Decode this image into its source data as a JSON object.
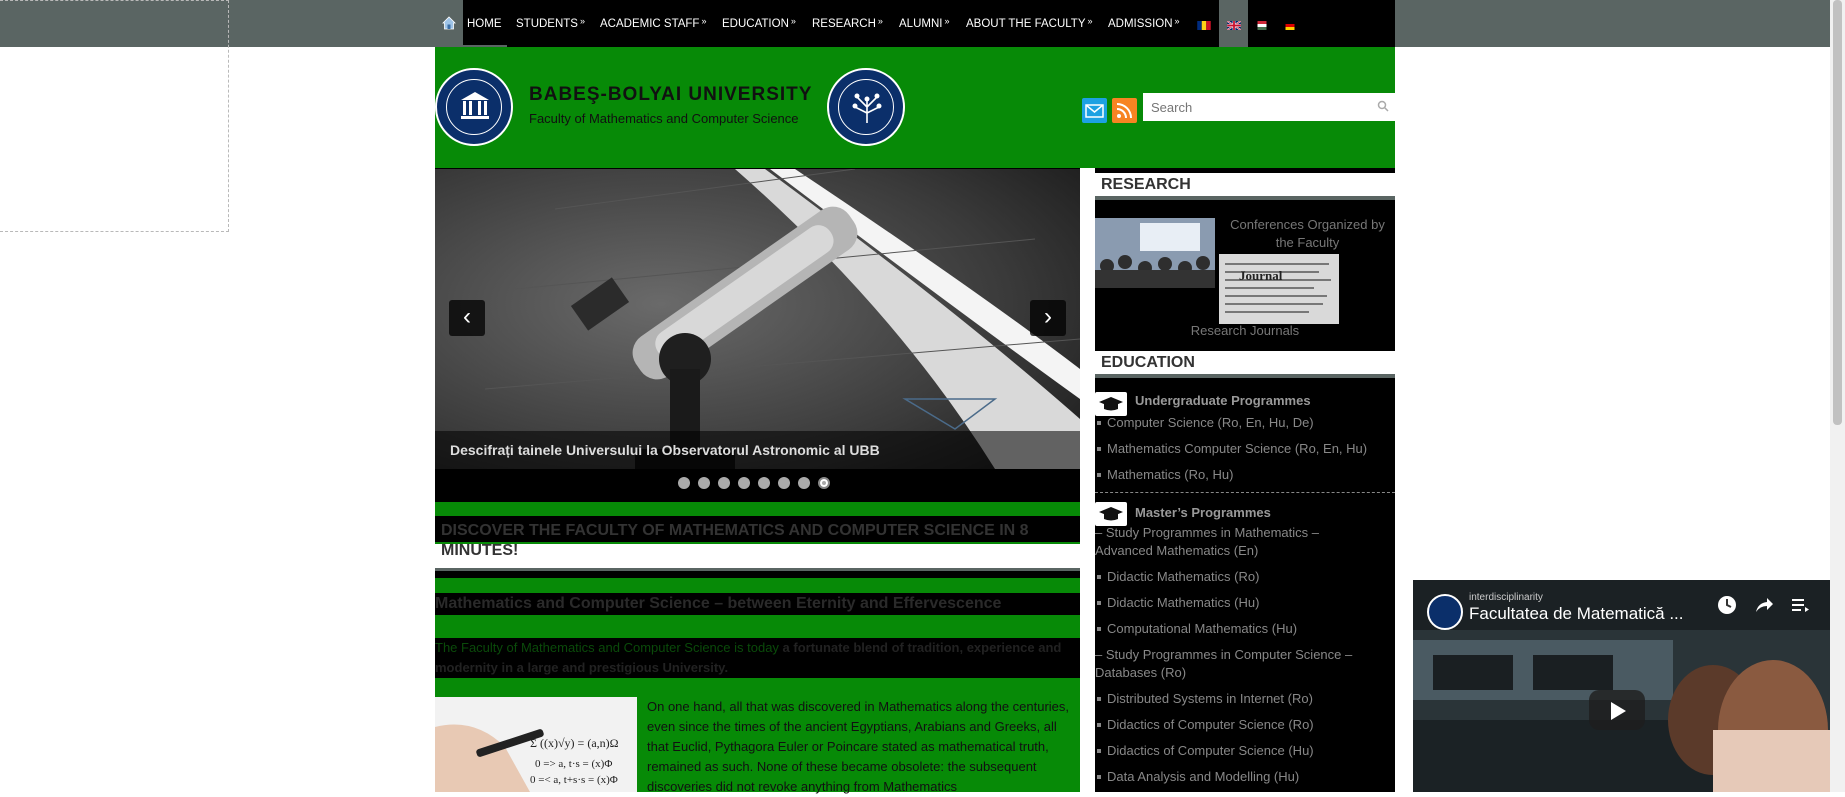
{
  "nav": {
    "items": [
      {
        "label": "HOME",
        "has_sub": false
      },
      {
        "label": "STUDENTS",
        "has_sub": true
      },
      {
        "label": "ACADEMIC STAFF",
        "has_sub": true
      },
      {
        "label": "EDUCATION",
        "has_sub": true
      },
      {
        "label": "RESEARCH",
        "has_sub": true
      },
      {
        "label": "ALUMNI",
        "has_sub": true
      },
      {
        "label": "ABOUT THE FACULTY",
        "has_sub": true
      },
      {
        "label": "ADMISSION",
        "has_sub": true
      }
    ],
    "submenu_marker": "»",
    "home_icon": "home-icon",
    "languages": [
      "ro",
      "en",
      "hu",
      "de"
    ],
    "active_language": "en"
  },
  "header": {
    "university": "BABEŞ-BOLYAI UNIVERSITY",
    "faculty": "Faculty of Mathematics and Computer Science",
    "search_placeholder": "Search",
    "icons": [
      "mail-icon",
      "rss-icon",
      "search-icon"
    ]
  },
  "slider": {
    "caption": "Descifrați tainele Universului la Observatorul Astronomic al UBB",
    "prev_label": "‹",
    "next_label": "›",
    "slide_count": 8,
    "active_slide": 8
  },
  "main": {
    "discover_title": "DISCOVER THE FACULTY OF MATHEMATICS AND COMPUTER SCIENCE IN 8 MINUTES!",
    "math_heading": "Mathematics and Computer Science – between Eternity and Effervescence",
    "intro_plain": "The Faculty of Mathematics and Computer Science is today ",
    "intro_bold": "a fortunate blend of tradition, experience and modernity in a large and prestigious University.",
    "body": "On one hand, all that was discovered in Mathematics along the centuries, even since the times of the ancient Egyptians, Arabians and Greeks, all that Euclid, Pythagora Euler or Poincare stated as mathematical truth, remained as such. None of these became obsolete: the subsequent discoveries did not revoke anything from Mathematics"
  },
  "sidebar": {
    "research": {
      "title": "RESEARCH",
      "conferences": "Conferences Organized by the Faculty",
      "journals": "Research Journals"
    },
    "education": {
      "title": "EDUCATION",
      "undergrad_heading": "Undergraduate Programmes",
      "undergrad": [
        "Computer Science (Ro, En, Hu, De)",
        "Mathematics Computer Science (Ro, En, Hu)",
        "Mathematics (Ro, Hu)"
      ],
      "masters_heading": "Master’s Programmes",
      "masters_group1": "– Study Programmes in Mathematics – Advanced Mathematics (En)",
      "masters_math": [
        "Didactic Mathematics (Ro)",
        "Didactic Mathematics (Hu)",
        "Computational Mathematics (Hu)"
      ],
      "masters_group2": "– Study Programmes in Computer Science – Databases (Ro)",
      "masters_cs": [
        "Distributed Systems in Internet (Ro)",
        "Didactics of Computer Science (Ro)",
        "Didactics of Computer Science (Hu)",
        "Data Analysis and Modelling (Hu)"
      ]
    }
  },
  "video": {
    "channel": "interdisciplinarity",
    "title": "Facultatea de Matematică ...",
    "icons": [
      "clock-icon",
      "share-icon",
      "playlist-icon",
      "play-icon"
    ]
  },
  "colors": {
    "brand_green": "#078a07",
    "nav_black": "#000000",
    "slate": "#5a6563"
  }
}
